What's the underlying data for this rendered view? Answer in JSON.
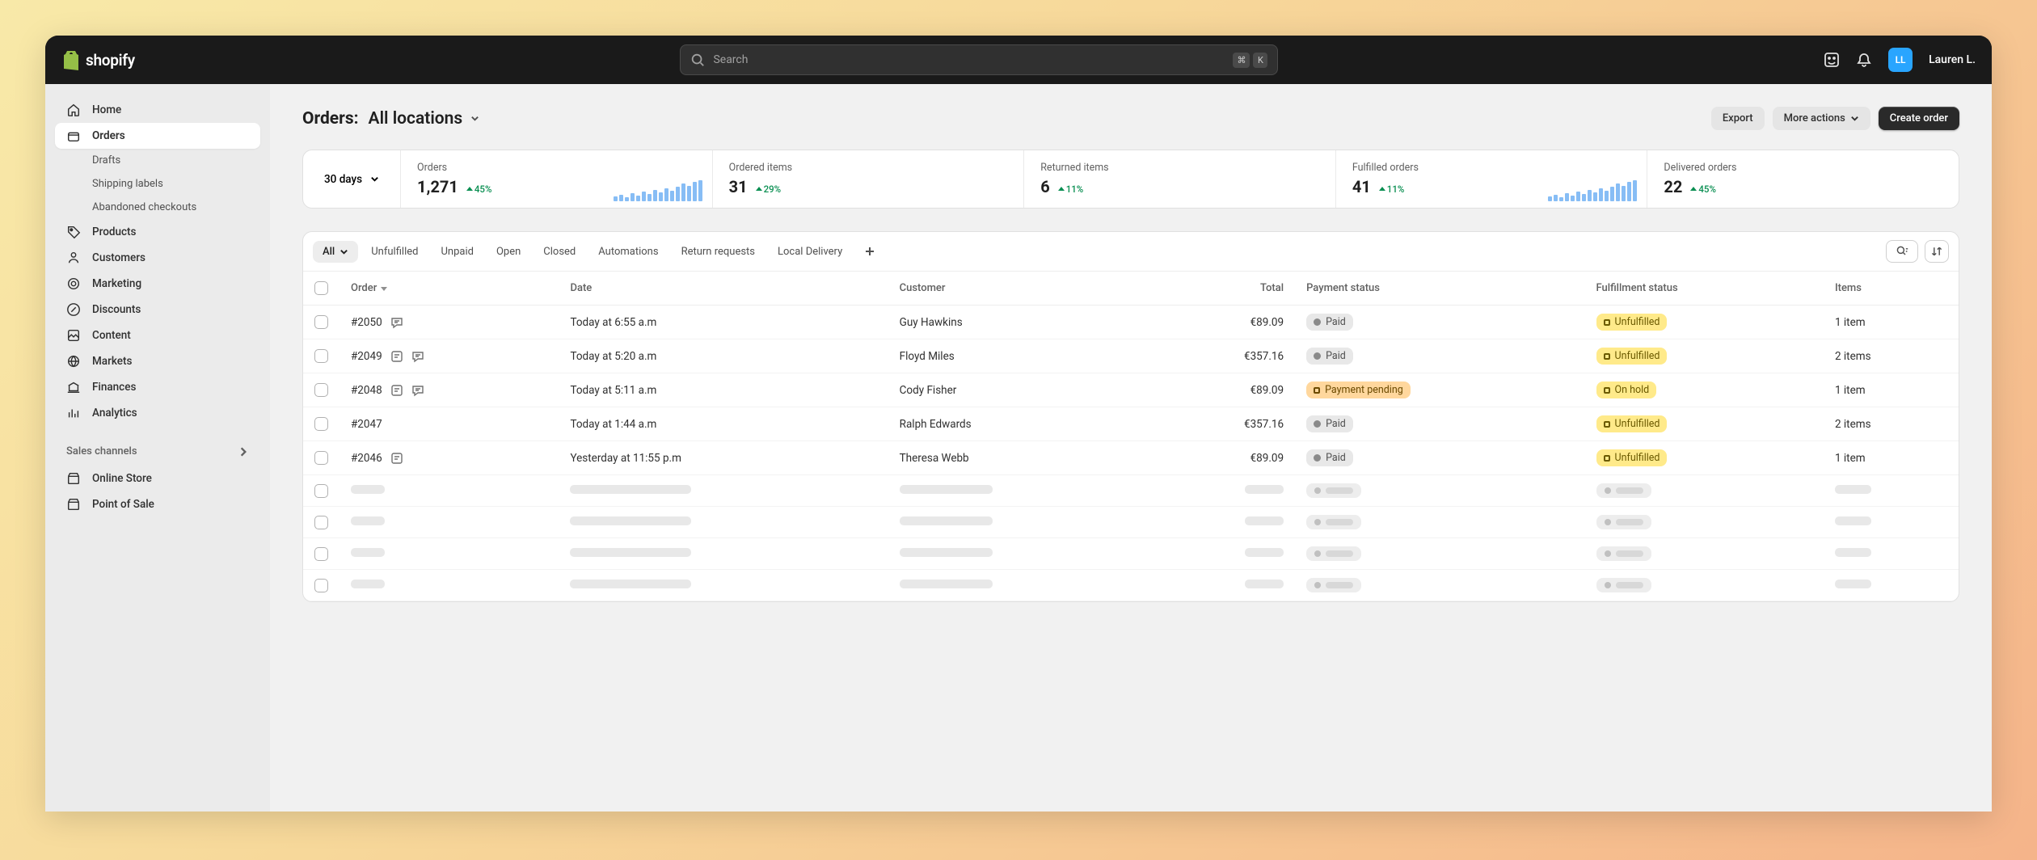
{
  "topbar": {
    "brand": "shopify",
    "search_placeholder": "Search",
    "shortcut_mod": "⌘",
    "shortcut_key": "K",
    "user_initials": "LL",
    "user_name": "Lauren L."
  },
  "sidebar": {
    "items": [
      {
        "label": "Home",
        "icon": "home"
      },
      {
        "label": "Orders",
        "icon": "orders",
        "active": true,
        "subs": [
          "Drafts",
          "Shipping labels",
          "Abandoned checkouts"
        ]
      },
      {
        "label": "Products",
        "icon": "tag"
      },
      {
        "label": "Customers",
        "icon": "person"
      },
      {
        "label": "Marketing",
        "icon": "target"
      },
      {
        "label": "Discounts",
        "icon": "discount"
      },
      {
        "label": "Content",
        "icon": "content"
      },
      {
        "label": "Markets",
        "icon": "globe"
      },
      {
        "label": "Finances",
        "icon": "bank"
      },
      {
        "label": "Analytics",
        "icon": "bars"
      }
    ],
    "section_label": "Sales channels",
    "channels": [
      "Online Store",
      "Point of Sale"
    ]
  },
  "page": {
    "title": "Orders:",
    "subtitle": "All locations",
    "actions": {
      "export": "Export",
      "more": "More actions",
      "create": "Create order"
    }
  },
  "stats": {
    "period": "30 days",
    "cards": [
      {
        "label": "Orders",
        "value": "1,271",
        "change": "45%",
        "spark": true
      },
      {
        "label": "Ordered items",
        "value": "31",
        "change": "29%"
      },
      {
        "label": "Returned items",
        "value": "6",
        "change": "11%"
      },
      {
        "label": "Fulfilled orders",
        "value": "41",
        "change": "11%",
        "spark": true
      },
      {
        "label": "Delivered orders",
        "value": "22",
        "change": "45%"
      }
    ]
  },
  "tabs": {
    "items": [
      "All",
      "Unfulfilled",
      "Unpaid",
      "Open",
      "Closed",
      "Automations",
      "Return requests",
      "Local Delivery"
    ],
    "active": 0
  },
  "table": {
    "headers": {
      "order": "Order",
      "date": "Date",
      "customer": "Customer",
      "total": "Total",
      "payment": "Payment status",
      "fulfillment": "Fulfillment status",
      "items": "Items"
    },
    "rows": [
      {
        "order": "#2050",
        "icons": [
          "chat"
        ],
        "date": "Today at 6:55 a.m",
        "customer": "Guy Hawkins",
        "total": "€89.09",
        "payment": {
          "text": "Paid",
          "type": "paid"
        },
        "fulfillment": {
          "text": "Unfulfilled",
          "type": "unfulfilled"
        },
        "items": "1 item"
      },
      {
        "order": "#2049",
        "icons": [
          "note",
          "chat"
        ],
        "date": "Today at 5:20 a.m",
        "customer": "Floyd Miles",
        "total": "€357.16",
        "payment": {
          "text": "Paid",
          "type": "paid"
        },
        "fulfillment": {
          "text": "Unfulfilled",
          "type": "unfulfilled"
        },
        "items": "2 items"
      },
      {
        "order": "#2048",
        "icons": [
          "note",
          "chat"
        ],
        "date": "Today at 5:11 a.m",
        "customer": "Cody Fisher",
        "total": "€89.09",
        "payment": {
          "text": "Payment pending",
          "type": "pending"
        },
        "fulfillment": {
          "text": "On hold",
          "type": "hold"
        },
        "items": "1 item"
      },
      {
        "order": "#2047",
        "icons": [],
        "date": "Today at 1:44 a.m",
        "customer": "Ralph Edwards",
        "total": "€357.16",
        "payment": {
          "text": "Paid",
          "type": "paid"
        },
        "fulfillment": {
          "text": "Unfulfilled",
          "type": "unfulfilled"
        },
        "items": "2 items"
      },
      {
        "order": "#2046",
        "icons": [
          "note"
        ],
        "date": "Yesterday at 11:55 p.m",
        "customer": "Theresa Webb",
        "total": "€89.09",
        "payment": {
          "text": "Paid",
          "type": "paid"
        },
        "fulfillment": {
          "text": "Unfulfilled",
          "type": "unfulfilled"
        },
        "items": "1 item"
      }
    ],
    "skeleton_rows": 4
  }
}
